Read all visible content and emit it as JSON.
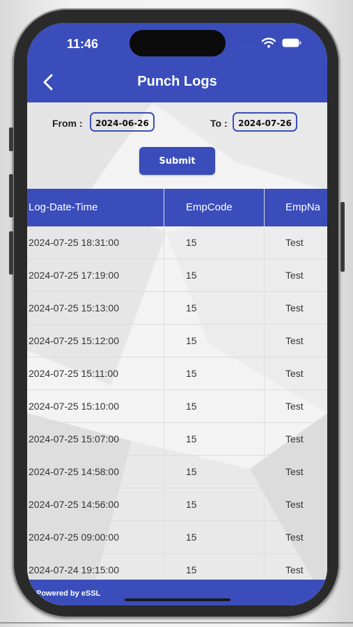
{
  "status_bar": {
    "time": "11:46",
    "signal": "····"
  },
  "header": {
    "title": "Punch Logs"
  },
  "filter": {
    "from_label": "From :",
    "from_value": "2024-06-26",
    "to_label": "To :",
    "to_value": "2024-07-26",
    "submit_label": "Submit"
  },
  "table": {
    "columns": [
      "Log-Date-Time",
      "EmpCode",
      "EmpNa"
    ],
    "rows": [
      [
        "2024-07-25 18:31:00",
        "15",
        "Test"
      ],
      [
        "2024-07-25 17:19:00",
        "15",
        "Test"
      ],
      [
        "2024-07-25 15:13:00",
        "15",
        "Test"
      ],
      [
        "2024-07-25 15:12:00",
        "15",
        "Test"
      ],
      [
        "2024-07-25 15:11:00",
        "15",
        "Test"
      ],
      [
        "2024-07-25 15:10:00",
        "15",
        "Test"
      ],
      [
        "2024-07-25 15:07:00",
        "15",
        "Test"
      ],
      [
        "2024-07-25 14:58:00",
        "15",
        "Test"
      ],
      [
        "2024-07-25 14:56:00",
        "15",
        "Test"
      ],
      [
        "2024-07-25 09:00:00",
        "15",
        "Test"
      ],
      [
        "2024-07-24 19:15:00",
        "15",
        "Test"
      ]
    ]
  },
  "footer": {
    "text": "Powered by eSSL"
  },
  "colors": {
    "primary": "#3a4dbb",
    "background": "#f3f3f3"
  },
  "icons": {
    "back": "chevron-left-icon",
    "wifi": "wifi-icon",
    "battery": "battery-icon"
  }
}
